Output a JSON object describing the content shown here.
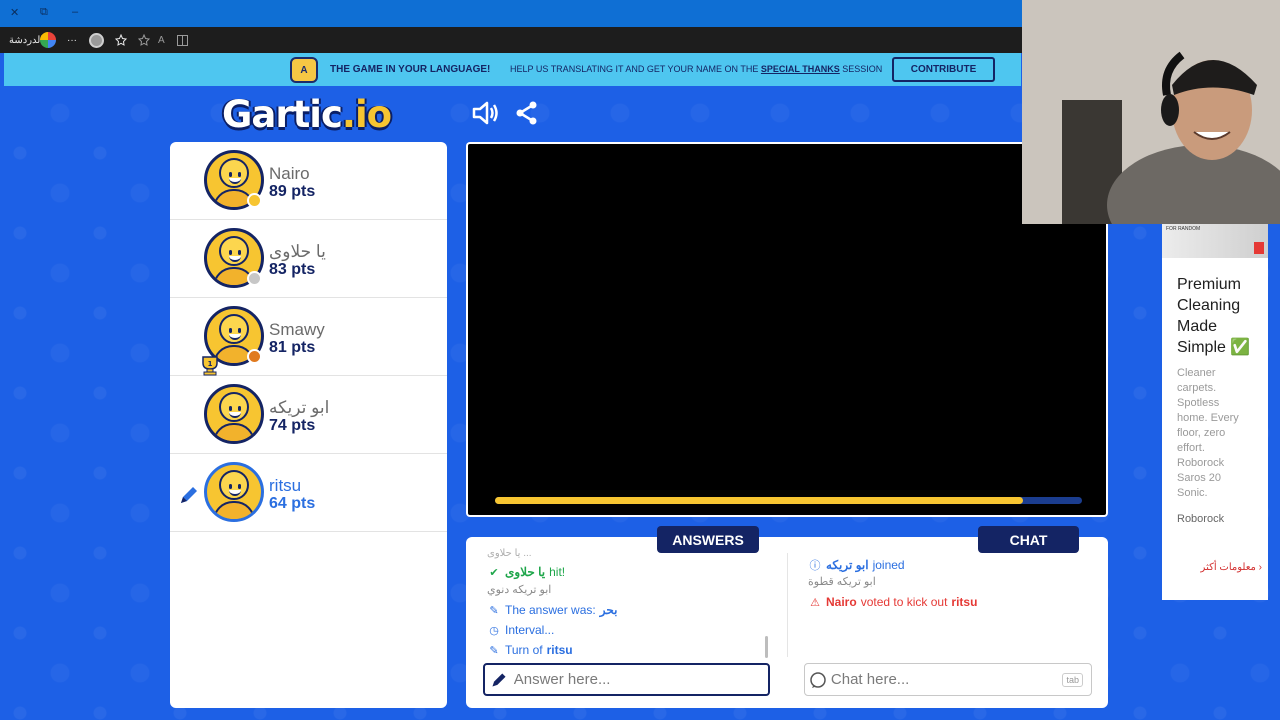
{
  "browser": {
    "titlebar_buttons": [
      "✕",
      "⧉",
      "–"
    ],
    "chat_label": "الدردشة",
    "more_label": "···",
    "read_aloud_label": "A",
    "accent": "#0f6fd4"
  },
  "banner": {
    "title": "THE GAME IN YOUR LANGUAGE!",
    "help_text_start": "HELP US TRANSLATING IT AND GET YOUR NAME ON THE",
    "help_link": "SPECIAL THANKS",
    "help_text_end": "SESSION",
    "contribute_label": "CONTRIBUTE",
    "icon_text": "A"
  },
  "logo": {
    "main": "Gartic",
    "accent": ".io"
  },
  "players": [
    {
      "name": "Nairo",
      "pts": "89 pts",
      "medal": "#f7c531"
    },
    {
      "name": "يا حلاوى",
      "pts": "83 pts",
      "medal": "#c7c7c7"
    },
    {
      "name": "Smawy",
      "pts": "81 pts",
      "medal": "#e07a1f",
      "trophy": "1"
    },
    {
      "name": "ابو تريكه",
      "pts": "74 pts"
    },
    {
      "name": "ritsu",
      "pts": "64 pts",
      "drawing": true
    }
  ],
  "timer": {
    "progress": 0.9
  },
  "answers": {
    "tab_label": "ANSWERS",
    "partial_top": "يا حلاوى ...",
    "hit_name": "يا حلاوى",
    "hit_text": "hit!",
    "guess_line": "ابو تريكه دنوي",
    "answer_prefix": "The answer was:",
    "answer_word": "بحر",
    "interval_text": "Interval...",
    "turn_prefix": "Turn of",
    "turn_name": "ritsu",
    "placeholder": "Answer here..."
  },
  "chat": {
    "tab_label": "CHAT",
    "joined_name": "ابو تريكه",
    "joined_text": "joined",
    "message": "ابو تريكه قطوة",
    "vote_name": "Nairo",
    "vote_text": "voted to kick out",
    "vote_target": "ritsu",
    "placeholder": "Chat here...",
    "tab_hint": "tab"
  },
  "ad": {
    "image_caption": "FOR RANDOM",
    "title": "Premium Cleaning Made Simple ✅",
    "text": "Cleaner carpets. Spotless home. Every floor, zero effort. Roborock Saros 20 Sonic.",
    "brand": "Roborock",
    "more": "معلومات أكثر"
  }
}
